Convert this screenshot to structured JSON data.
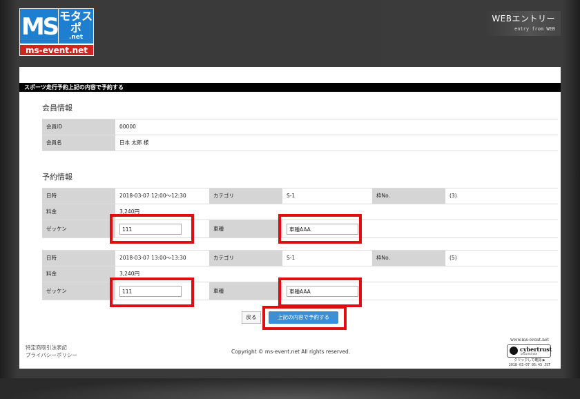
{
  "header": {
    "logo_ms": "MS",
    "logo_jp": "モタスポ",
    "logo_net": ".net",
    "logo_domain": "ms-event.net",
    "web_entry_title": "WEBエントリー",
    "web_entry_sub": "entry from WEB"
  },
  "page_title": "スポーツ走行予約上記の内容で予約する",
  "member": {
    "heading": "会員情報",
    "id_label": "会員ID",
    "id_value": "00000",
    "name_label": "会員名",
    "name_value": "日本 太郎 様"
  },
  "reservation": {
    "heading": "予約情報",
    "date_label": "日時",
    "category_label": "カテゴリ",
    "slot_label": "枠No.",
    "fee_label": "料金",
    "bib_label": "ゼッケン",
    "car_label": "車種",
    "items": [
      {
        "date": "2018-03-07 12:00〜12:30",
        "category": "S-1",
        "slot": "(3)",
        "fee": "3,240円",
        "bib": "111",
        "car": "車種AAA"
      },
      {
        "date": "2018-03-07 13:00〜13:30",
        "category": "S-1",
        "slot": "(5)",
        "fee": "3,240円",
        "bib": "111",
        "car": "車種AAA"
      }
    ]
  },
  "actions": {
    "back_label": "戻る",
    "submit_label": "上記の内容で予約する"
  },
  "footer": {
    "link_law": "特定商取引法表記",
    "link_privacy": "プライバシーポリシー",
    "copyright": "Copyright © ms-event.net All rights reserved.",
    "seal_url": "www.ms-event.net",
    "seal_brand": "cybertrust",
    "seal_sub": "secured site",
    "seal_click": "クリックして確認 ▶",
    "seal_date": "2018-03-07 05:43 JST"
  },
  "colors": {
    "highlight": "#e00d10",
    "submit_button": "#3b8fd6",
    "label_bg": "#d5d5d5",
    "title_bar": "#000000"
  }
}
